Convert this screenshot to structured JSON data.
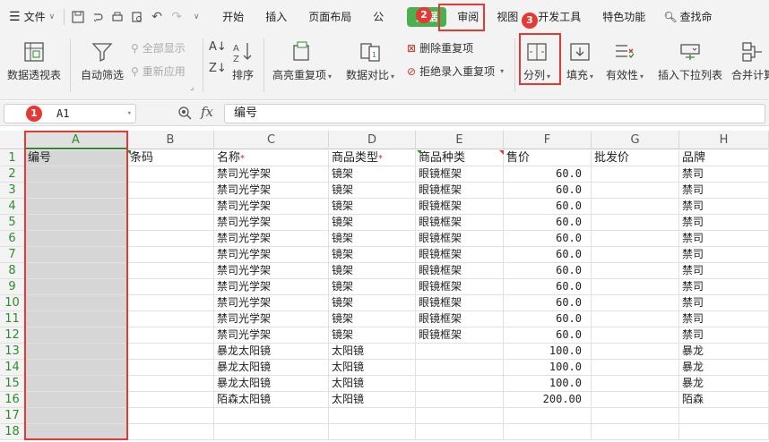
{
  "menu": {
    "file_label": "文件",
    "tabs": [
      "开始",
      "插入",
      "页面布局",
      "公",
      "数据",
      "审阅",
      "视图",
      "开发工具",
      "特色功能"
    ],
    "active_tab": "数据",
    "search_label": "查找命"
  },
  "ribbon": {
    "pivot_table": "数据透视表",
    "auto_filter": "自动筛选",
    "show_all": "全部显示",
    "reapply": "重新应用",
    "sort": "排序",
    "highlight_duplicates": "高亮重复项",
    "data_compare": "数据对比",
    "remove_duplicates": "删除重复项",
    "reject_duplicates": "拒绝录入重复项",
    "split_column": "分列",
    "fill": "填充",
    "validity": "有效性",
    "insert_dropdown": "插入下拉列表",
    "merge_calc": "合并计算"
  },
  "formula_bar": {
    "name_box": "A1",
    "fx_label": "fx",
    "formula": "编号"
  },
  "annotations": [
    "1",
    "2",
    "3"
  ],
  "columns": [
    "A",
    "B",
    "C",
    "D",
    "E",
    "F",
    "G",
    "H"
  ],
  "header_row": [
    "编号",
    "条码",
    "名称",
    "商品类型",
    "商品种类",
    "售价",
    "批发价",
    "品牌"
  ],
  "required_marker": "*",
  "rows": [
    {
      "num": "2",
      "name": "禁司光学架",
      "type": "镜架",
      "kind": "眼镜框架",
      "price": "60.0",
      "brand": "禁司"
    },
    {
      "num": "3",
      "name": "禁司光学架",
      "type": "镜架",
      "kind": "眼镜框架",
      "price": "60.0",
      "brand": "禁司"
    },
    {
      "num": "4",
      "name": "禁司光学架",
      "type": "镜架",
      "kind": "眼镜框架",
      "price": "60.0",
      "brand": "禁司"
    },
    {
      "num": "5",
      "name": "禁司光学架",
      "type": "镜架",
      "kind": "眼镜框架",
      "price": "60.0",
      "brand": "禁司"
    },
    {
      "num": "6",
      "name": "禁司光学架",
      "type": "镜架",
      "kind": "眼镜框架",
      "price": "60.0",
      "brand": "禁司"
    },
    {
      "num": "7",
      "name": "禁司光学架",
      "type": "镜架",
      "kind": "眼镜框架",
      "price": "60.0",
      "brand": "禁司"
    },
    {
      "num": "8",
      "name": "禁司光学架",
      "type": "镜架",
      "kind": "眼镜框架",
      "price": "60.0",
      "brand": "禁司"
    },
    {
      "num": "9",
      "name": "禁司光学架",
      "type": "镜架",
      "kind": "眼镜框架",
      "price": "60.0",
      "brand": "禁司"
    },
    {
      "num": "10",
      "name": "禁司光学架",
      "type": "镜架",
      "kind": "眼镜框架",
      "price": "60.0",
      "brand": "禁司"
    },
    {
      "num": "11",
      "name": "禁司光学架",
      "type": "镜架",
      "kind": "眼镜框架",
      "price": "60.0",
      "brand": "禁司"
    },
    {
      "num": "12",
      "name": "禁司光学架",
      "type": "镜架",
      "kind": "眼镜框架",
      "price": "60.0",
      "brand": "禁司"
    },
    {
      "num": "13",
      "name": "暴龙太阳镜",
      "type": "太阳镜",
      "kind": "",
      "price": "100.0",
      "brand": "暴龙"
    },
    {
      "num": "14",
      "name": "暴龙太阳镜",
      "type": "太阳镜",
      "kind": "",
      "price": "100.0",
      "brand": "暴龙"
    },
    {
      "num": "15",
      "name": "暴龙太阳镜",
      "type": "太阳镜",
      "kind": "",
      "price": "100.0",
      "brand": "暴龙"
    },
    {
      "num": "16",
      "name": "陌森太阳镜",
      "type": "太阳镜",
      "kind": "",
      "price": "200.00",
      "brand": "陌森"
    },
    {
      "num": "17",
      "name": "",
      "type": "",
      "kind": "",
      "price": "",
      "brand": ""
    },
    {
      "num": "18",
      "name": "",
      "type": "",
      "kind": "",
      "price": "",
      "brand": ""
    }
  ],
  "colors": {
    "accent_green": "#4caf50",
    "highlight_red": "#e53935",
    "row_header_green": "#2e8b2e"
  }
}
